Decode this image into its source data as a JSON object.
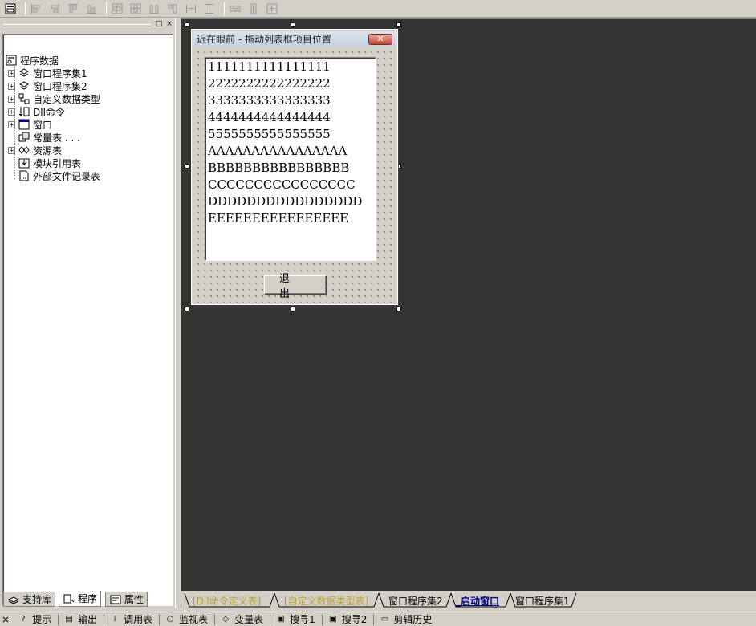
{
  "toolbar": {
    "icons": [
      "form-layout-icon",
      "align-left-icon",
      "align-right-icon",
      "align-top-icon",
      "align-bottom-icon",
      "center-horizontal-icon",
      "center-vertical-icon",
      "distribute-horizontal-icon",
      "distribute-vertical-icon",
      "space-horizontal-icon",
      "space-vertical-icon",
      "same-width-icon",
      "same-height-icon",
      "same-size-icon"
    ]
  },
  "left_panel": {
    "pin_label": "□",
    "close_label": "×",
    "tree": {
      "root": "程序数据",
      "items": [
        {
          "label": "窗口程序集1",
          "expandable": true
        },
        {
          "label": "窗口程序集2",
          "expandable": true
        },
        {
          "label": "自定义数据类型",
          "expandable": true
        },
        {
          "label": "Dll命令",
          "expandable": true
        },
        {
          "label": "窗口",
          "expandable": true
        },
        {
          "label": "常量表 . . .",
          "expandable": false
        },
        {
          "label": "资源表",
          "expandable": true
        },
        {
          "label": "模块引用表",
          "expandable": false
        },
        {
          "label": "外部文件记录表",
          "expandable": false
        }
      ]
    },
    "tabs": [
      {
        "label": "支持库"
      },
      {
        "label": "程序"
      },
      {
        "label": "属性"
      }
    ]
  },
  "form": {
    "title": "近在眼前 - 拖动列表框项目位置",
    "close_label": "✕",
    "list_items": [
      "1111111111111111",
      "2222222222222222",
      "3333333333333333",
      "4444444444444444",
      "5555555555555555",
      "AAAAAAAAAAAAAAAA",
      "BBBBBBBBBBBBBBBB",
      "CCCCCCCCCCCCCCCC",
      "DDDDDDDDDDDDDDDD",
      "EEEEEEEEEEEEEEEE"
    ],
    "exit_button": "退出"
  },
  "doc_tabs": [
    {
      "label": "[Dll命令定义表]",
      "state": "dim"
    },
    {
      "label": "[自定义数据类型表]",
      "state": "dim"
    },
    {
      "label": "窗口程序集2",
      "state": "normal"
    },
    {
      "label": "_启动窗口",
      "state": "active"
    },
    {
      "label": "窗口程序集1",
      "state": "normal"
    }
  ],
  "status_bar": {
    "close_label": "×",
    "items": [
      {
        "label": "提示",
        "icon": "tip-icon"
      },
      {
        "label": "输出",
        "icon": "output-icon"
      },
      {
        "label": "调用表",
        "icon": "call-table-icon"
      },
      {
        "label": "监视表",
        "icon": "watch-icon"
      },
      {
        "label": "变量表",
        "icon": "variable-icon"
      },
      {
        "label": "搜寻1",
        "icon": "search1-icon"
      },
      {
        "label": "搜寻2",
        "icon": "search2-icon"
      },
      {
        "label": "剪辑历史",
        "icon": "clip-history-icon"
      }
    ]
  },
  "colors": {
    "designer_bg": "#333333",
    "chrome": "#d4d0c8",
    "active_tab": "#000080",
    "dim_tab": "#b8a030"
  }
}
